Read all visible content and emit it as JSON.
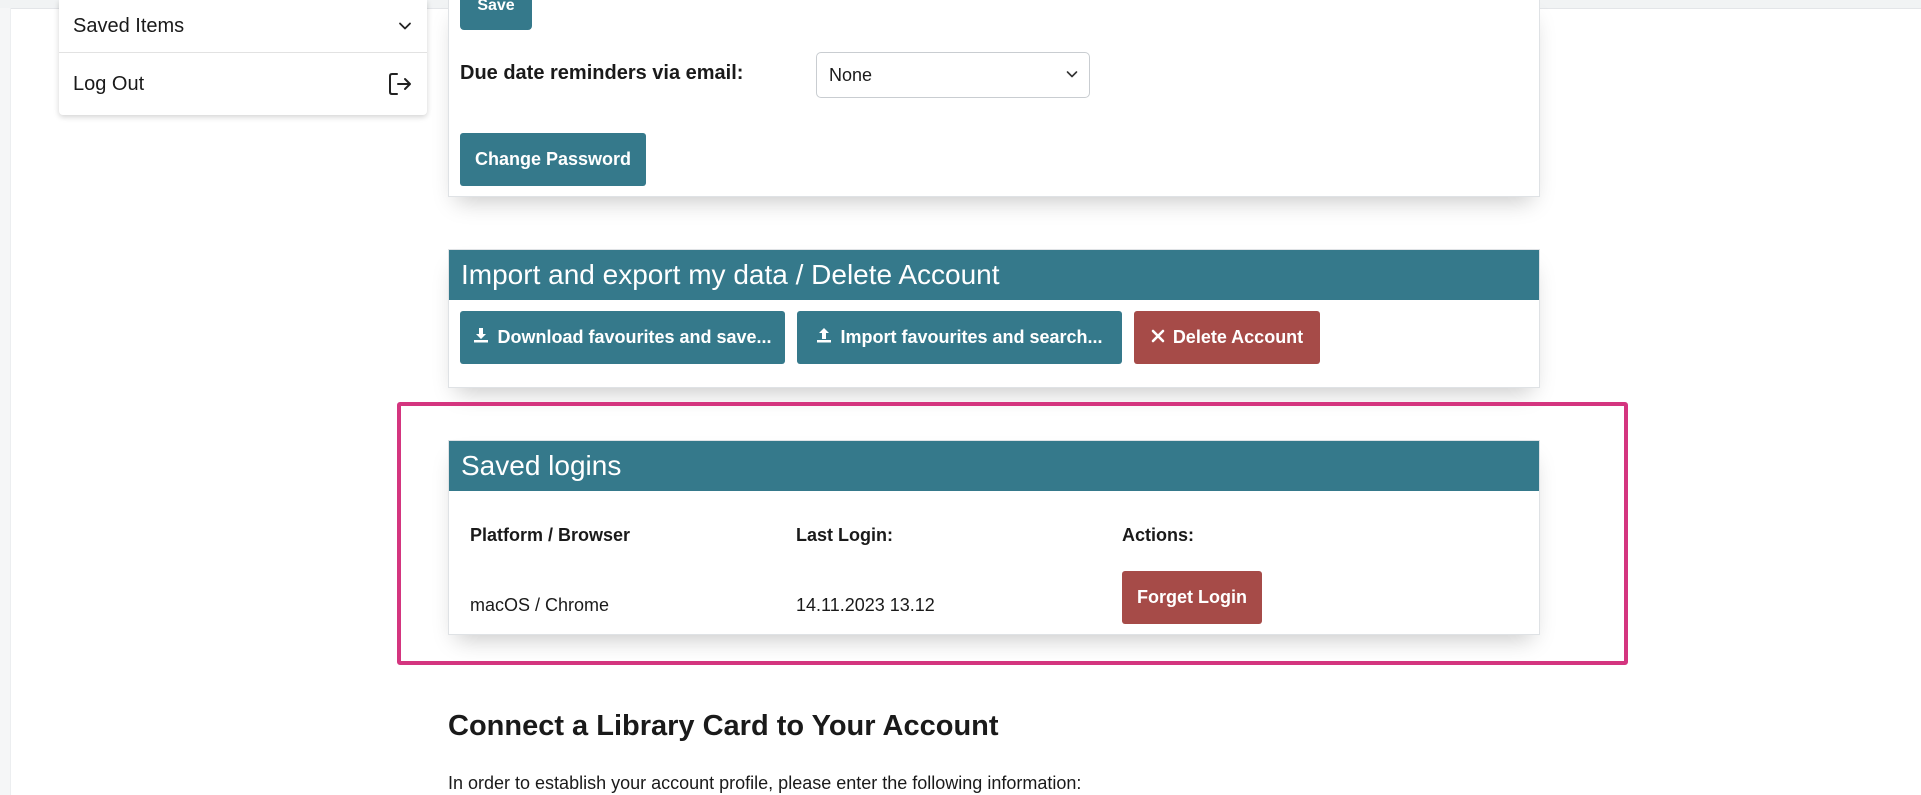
{
  "sidebar": {
    "items": [
      {
        "label": "Saved Items",
        "icon": "chevron-down-icon"
      },
      {
        "label": "Log Out",
        "icon": "logout-icon"
      }
    ]
  },
  "account_settings": {
    "save_button_label": "Save",
    "due_date_label": "Due date reminders via email:",
    "due_date_selected": "None",
    "change_password_label": "Change Password"
  },
  "data_section": {
    "title": "Import and export my data / Delete Account",
    "download_label": "Download favourites and save...",
    "import_label": "Import favourites and search...",
    "delete_label": "Delete Account"
  },
  "saved_logins": {
    "title": "Saved logins",
    "columns": [
      "Platform / Browser",
      "Last Login:",
      "Actions:"
    ],
    "rows": [
      {
        "platform": "macOS / Chrome",
        "last_login": "14.11.2023 13.12",
        "action_label": "Forget Login"
      }
    ]
  },
  "library_card": {
    "title": "Connect a Library Card to Your Account",
    "intro": "In order to establish your account profile, please enter the following information:"
  },
  "colors": {
    "accent_teal": "#35798b",
    "danger_red": "#a64b48",
    "highlight_pink": "#d4357f"
  }
}
